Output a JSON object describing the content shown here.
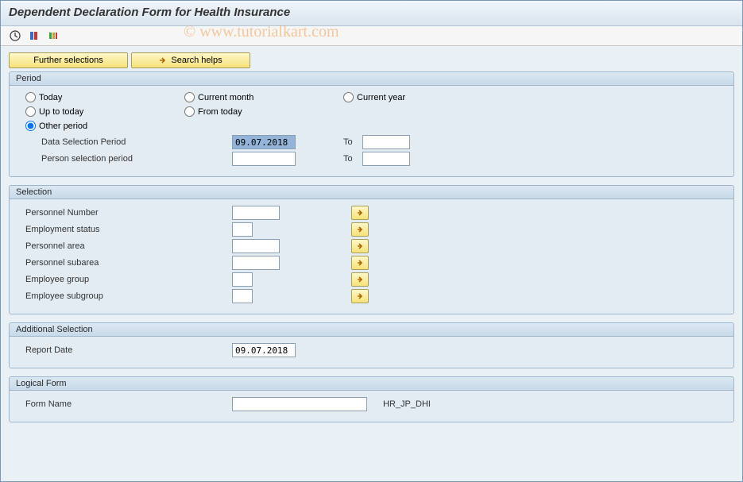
{
  "title": "Dependent Declaration Form for Health Insurance",
  "watermark": "© www.tutorialkart.com",
  "action_buttons": {
    "further_selections": "Further selections",
    "search_helps": "Search helps"
  },
  "period": {
    "title": "Period",
    "options": {
      "today": "Today",
      "current_month": "Current month",
      "current_year": "Current year",
      "up_to_today": "Up to today",
      "from_today": "From today",
      "other_period": "Other period"
    },
    "fields": {
      "data_selection_label": "Data Selection Period",
      "data_selection_from": "09.07.2018",
      "data_selection_to": "",
      "person_selection_label": "Person selection period",
      "person_selection_from": "",
      "person_selection_to": "",
      "to_label": "To"
    }
  },
  "selection": {
    "title": "Selection",
    "fields": {
      "personnel_number": {
        "label": "Personnel Number",
        "value": ""
      },
      "employment_status": {
        "label": "Employment status",
        "value": ""
      },
      "personnel_area": {
        "label": "Personnel area",
        "value": ""
      },
      "personnel_subarea": {
        "label": "Personnel subarea",
        "value": ""
      },
      "employee_group": {
        "label": "Employee group",
        "value": ""
      },
      "employee_subgroup": {
        "label": "Employee subgroup",
        "value": ""
      }
    }
  },
  "additional_selection": {
    "title": "Additional Selection",
    "report_date_label": "Report Date",
    "report_date_value": "09.07.2018"
  },
  "logical_form": {
    "title": "Logical Form",
    "form_name_label": "Form Name",
    "form_name_value": "",
    "form_name_suffix": "HR_JP_DHI"
  }
}
